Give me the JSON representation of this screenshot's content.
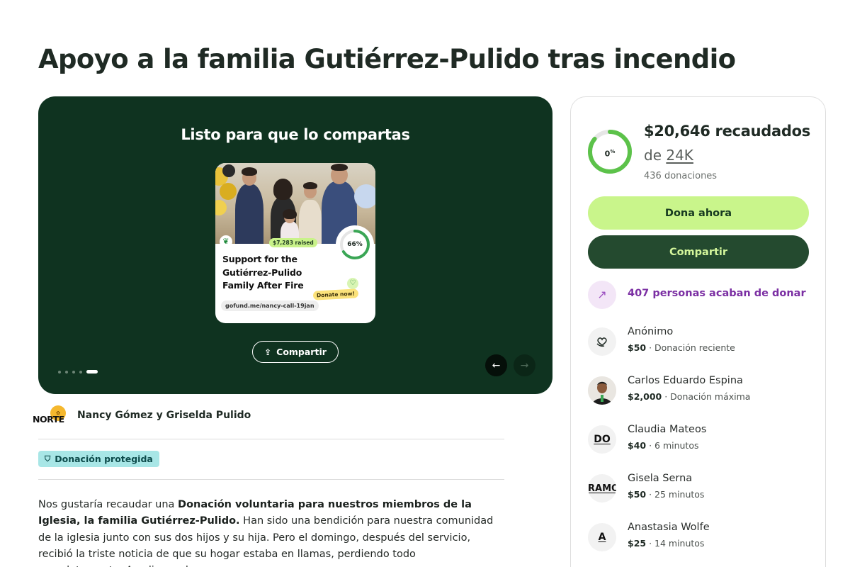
{
  "page": {
    "title": "Apoyo a la familia Gutiérrez-Pulido tras incendio"
  },
  "hero": {
    "heading": "Listo para que lo compartas",
    "share_button": "Compartir",
    "slides_total": 5,
    "active_slide": 5,
    "card": {
      "raised_chip": "$7,283 raised",
      "progress_label": "66%",
      "progress": 0.66,
      "campaign_title": "Support for the Gutiérrez-Pulido Family After Fire",
      "donate_chip": "Donate now!",
      "url": "gofund.me/nancy-call-19jan"
    }
  },
  "organizer": {
    "logo_text": "NORTE",
    "names": "Nancy Gómez y Griselda Pulido"
  },
  "badge": {
    "protected": "Donación protegida"
  },
  "story": {
    "intro": "Nos gustaría recaudar una ",
    "bold": "Donación voluntaria para nuestros miembros de la Iglesia, la familia Gutiérrez-Pulido.",
    "rest": " Han sido una bendición para nuestra comunidad de la iglesia junto con sus dos hijos y su hija. Pero el domingo, después del servicio, recibió la triste noticia de que su hogar estaba en llamas, perdiendo todo completamente. Acudimos al"
  },
  "sidebar": {
    "progress_label": "0",
    "progress_suffix": "%",
    "progress": 0.86,
    "raised": "$20,646 recaudados",
    "goal_prefix": "de ",
    "goal_value": "24K",
    "donations": "436 donaciones",
    "donate_button": "Dona ahora",
    "share_button": "Compartir",
    "trending": "407 personas acaban de donar",
    "donors": [
      {
        "avatar": "heart-hands",
        "name": "Anónimo",
        "amount": "$50",
        "detail": " · Donación reciente"
      },
      {
        "avatar": "photo",
        "name": "Carlos Eduardo Espina",
        "amount": "$2,000",
        "detail": " · Donación máxima"
      },
      {
        "avatar": "DO",
        "name": "Claudia Mateos",
        "amount": "$40",
        "detail": " · 6 minutos"
      },
      {
        "avatar": "RAMO",
        "name": "Gisela Serna",
        "amount": "$50",
        "detail": " · 25 minutos"
      },
      {
        "avatar": "A",
        "name": "Anastasia Wolfe",
        "amount": "$25",
        "detail": " · 14 minutos"
      }
    ]
  },
  "colors": {
    "hero_bg": "#0f3320",
    "donate_green": "#c9f58b",
    "share_dark": "#244a2f",
    "progress_green": "#5cc24a",
    "trending_purple": "#7b2fa3",
    "badge_teal": "#a8e6e6"
  }
}
